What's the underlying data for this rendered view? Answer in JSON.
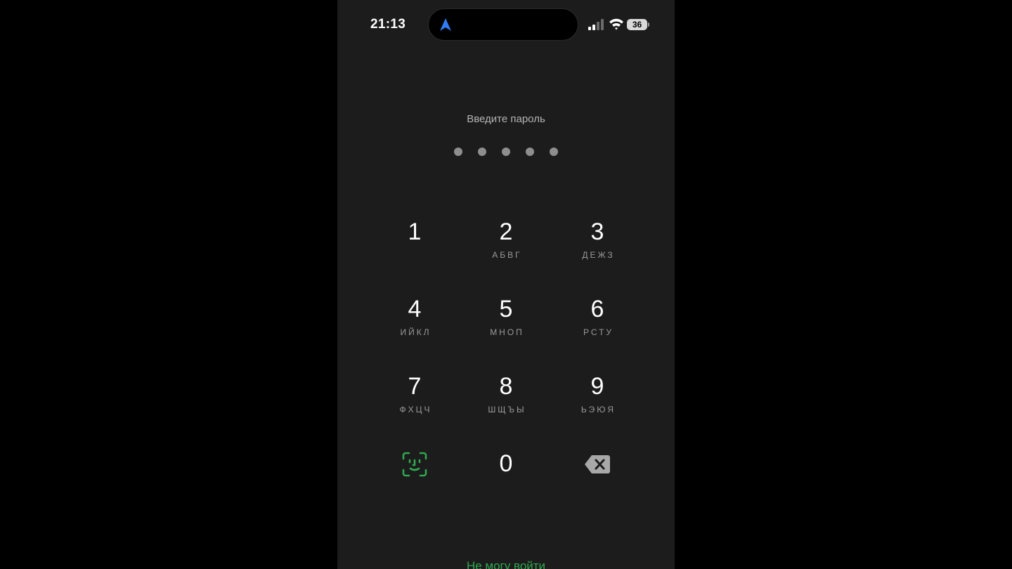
{
  "status_bar": {
    "time": "21:13",
    "battery": "36",
    "icons": [
      "navigation-arrow-icon",
      "signal-icon",
      "wifi-icon",
      "battery-icon"
    ]
  },
  "passcode": {
    "prompt": "Введите пароль",
    "dot_count": 5
  },
  "keypad": {
    "keys": [
      {
        "digit": "1",
        "letters": ""
      },
      {
        "digit": "2",
        "letters": "АБВГ"
      },
      {
        "digit": "3",
        "letters": "ДЕЖЗ"
      },
      {
        "digit": "4",
        "letters": "ИЙКЛ"
      },
      {
        "digit": "5",
        "letters": "МНОП"
      },
      {
        "digit": "6",
        "letters": "РСТУ"
      },
      {
        "digit": "7",
        "letters": "ФХЦЧ"
      },
      {
        "digit": "8",
        "letters": "ШЩЪЫ"
      },
      {
        "digit": "9",
        "letters": "ЬЭЮЯ"
      },
      {
        "digit": "0",
        "letters": ""
      }
    ],
    "left_icon": "face-id-icon",
    "right_icon": "backspace-icon"
  },
  "footer": {
    "cant_login": "Не могу войти"
  },
  "colors": {
    "background": "#1c1c1c",
    "accent": "#2fa84f",
    "nav_arrow": "#2f7cf6"
  }
}
